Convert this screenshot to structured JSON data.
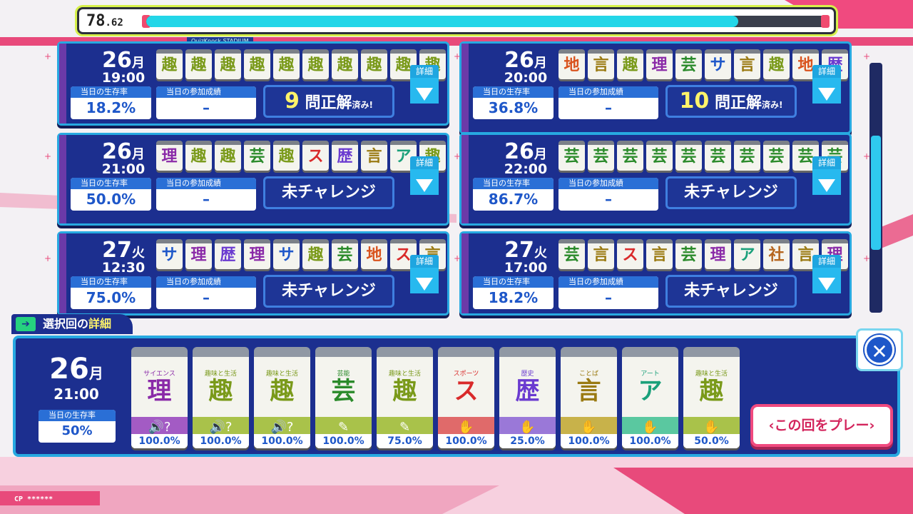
{
  "top": {
    "score_int": "78",
    "score_dec": ".62",
    "progress": 0.87,
    "sub_label": "QuizKnock STADIUM"
  },
  "cards": [
    {
      "date": "26",
      "weekday": "月",
      "time": "19:00",
      "tiles": [
        "趣",
        "趣",
        "趣",
        "趣",
        "趣",
        "趣",
        "趣",
        "趣",
        "趣",
        "趣"
      ],
      "tile_colors": [
        "#7a9a1a",
        "#7a9a1a",
        "#7a9a1a",
        "#7a9a1a",
        "#7a9a1a",
        "#7a9a1a",
        "#7a9a1a",
        "#7a9a1a",
        "#7a9a1a",
        "#7a9a1a"
      ],
      "rate_label": "当日の生存率",
      "rate": "18.2%",
      "result_label": "当日の参加成績",
      "result": "–",
      "challenge_num": "9",
      "challenge_text": "問正解",
      "challenge_suffix": "済み!",
      "detail": "詳細"
    },
    {
      "date": "26",
      "weekday": "月",
      "time": "20:00",
      "tiles": [
        "地",
        "言",
        "趣",
        "理",
        "芸",
        "サ",
        "言",
        "趣",
        "地",
        "歴"
      ],
      "tile_colors": [
        "#d9531e",
        "#9a7a12",
        "#7a9a1a",
        "#8a2aa8",
        "#2a8a2a",
        "#1e57c9",
        "#9a7a12",
        "#7a9a1a",
        "#d9531e",
        "#6a3ad0"
      ],
      "rate_label": "当日の生存率",
      "rate": "36.8%",
      "result_label": "当日の参加成績",
      "result": "–",
      "challenge_num": "10",
      "challenge_text": "問正解",
      "challenge_suffix": "済み!",
      "detail": "詳細"
    },
    {
      "date": "26",
      "weekday": "月",
      "time": "21:00",
      "tiles": [
        "理",
        "趣",
        "趣",
        "芸",
        "趣",
        "ス",
        "歴",
        "言",
        "ア",
        "趣"
      ],
      "tile_colors": [
        "#8a2aa8",
        "#7a9a1a",
        "#7a9a1a",
        "#2a8a2a",
        "#7a9a1a",
        "#d92a2a",
        "#6a3ad0",
        "#9a7a12",
        "#1aa07a",
        "#7a9a1a"
      ],
      "rate_label": "当日の生存率",
      "rate": "50.0%",
      "result_label": "当日の参加成績",
      "result": "–",
      "challenge_text": "未チャレンジ",
      "detail": "詳細"
    },
    {
      "date": "26",
      "weekday": "月",
      "time": "22:00",
      "tiles": [
        "芸",
        "芸",
        "芸",
        "芸",
        "芸",
        "芸",
        "芸",
        "芸",
        "芸",
        "芸"
      ],
      "tile_colors": [
        "#2a8a2a",
        "#2a8a2a",
        "#2a8a2a",
        "#2a8a2a",
        "#2a8a2a",
        "#2a8a2a",
        "#2a8a2a",
        "#2a8a2a",
        "#2a8a2a",
        "#2a8a2a"
      ],
      "rate_label": "当日の生存率",
      "rate": "86.7%",
      "result_label": "当日の参加成績",
      "result": "–",
      "challenge_text": "未チャレンジ",
      "detail": "詳細"
    },
    {
      "date": "27",
      "weekday": "火",
      "time": "12:30",
      "tiles": [
        "サ",
        "理",
        "歴",
        "理",
        "サ",
        "趣",
        "芸",
        "地",
        "ス",
        "言"
      ],
      "tile_colors": [
        "#1e57c9",
        "#8a2aa8",
        "#6a3ad0",
        "#8a2aa8",
        "#1e57c9",
        "#7a9a1a",
        "#2a8a2a",
        "#d9531e",
        "#d92a2a",
        "#9a7a12"
      ],
      "rate_label": "当日の生存率",
      "rate": "75.0%",
      "result_label": "当日の参加成績",
      "result": "–",
      "challenge_text": "未チャレンジ",
      "detail": "詳細"
    },
    {
      "date": "27",
      "weekday": "火",
      "time": "17:00",
      "tiles": [
        "芸",
        "言",
        "ス",
        "言",
        "芸",
        "理",
        "ア",
        "社",
        "言",
        "理"
      ],
      "tile_colors": [
        "#2a8a2a",
        "#9a7a12",
        "#d92a2a",
        "#9a7a12",
        "#2a8a2a",
        "#8a2aa8",
        "#1aa07a",
        "#b5651d",
        "#9a7a12",
        "#8a2aa8"
      ],
      "rate_label": "当日の生存率",
      "rate": "18.2%",
      "result_label": "当日の参加成績",
      "result": "–",
      "challenge_text": "未チャレンジ",
      "detail": "詳細"
    }
  ],
  "panel": {
    "header_prefix": "選択回の",
    "header_highlight": "詳細",
    "date": "26",
    "weekday": "月",
    "time": "21:00",
    "rate_label": "当日の生存率",
    "rate": "50%",
    "questions": [
      {
        "category": "サイエンス",
        "char": "理",
        "pct": "100.0%",
        "color": "#8a2aa8",
        "band": "#a35bc4",
        "icon": "🔊?"
      },
      {
        "category": "趣味と生活",
        "char": "趣",
        "pct": "100.0%",
        "color": "#7a9a1a",
        "band": "#a9c24a",
        "icon": "🔊?"
      },
      {
        "category": "趣味と生活",
        "char": "趣",
        "pct": "100.0%",
        "color": "#7a9a1a",
        "band": "#a9c24a",
        "icon": "🔊?"
      },
      {
        "category": "芸能",
        "char": "芸",
        "pct": "100.0%",
        "color": "#2a8a2a",
        "band": "#a9c24a",
        "icon": "✎"
      },
      {
        "category": "趣味と生活",
        "char": "趣",
        "pct": "75.0%",
        "color": "#7a9a1a",
        "band": "#a9c24a",
        "icon": "✎"
      },
      {
        "category": "スポーツ",
        "char": "ス",
        "pct": "100.0%",
        "color": "#d92a2a",
        "band": "#e06a6a",
        "icon": "✋"
      },
      {
        "category": "歴史",
        "char": "歴",
        "pct": "25.0%",
        "color": "#6a3ad0",
        "band": "#9a78d8",
        "icon": "✋"
      },
      {
        "category": "ことば",
        "char": "言",
        "pct": "100.0%",
        "color": "#9a7a12",
        "band": "#c8b24a",
        "icon": "✋"
      },
      {
        "category": "アート",
        "char": "ア",
        "pct": "100.0%",
        "color": "#1aa07a",
        "band": "#5ac8a0",
        "icon": "✋"
      },
      {
        "category": "趣味と生活",
        "char": "趣",
        "pct": "50.0%",
        "color": "#7a9a1a",
        "band": "#a9c24a",
        "icon": "✋"
      }
    ],
    "play_label": "‹この回をプレー›",
    "close_label": "✕"
  },
  "footer": {
    "cp": "CP ******"
  }
}
